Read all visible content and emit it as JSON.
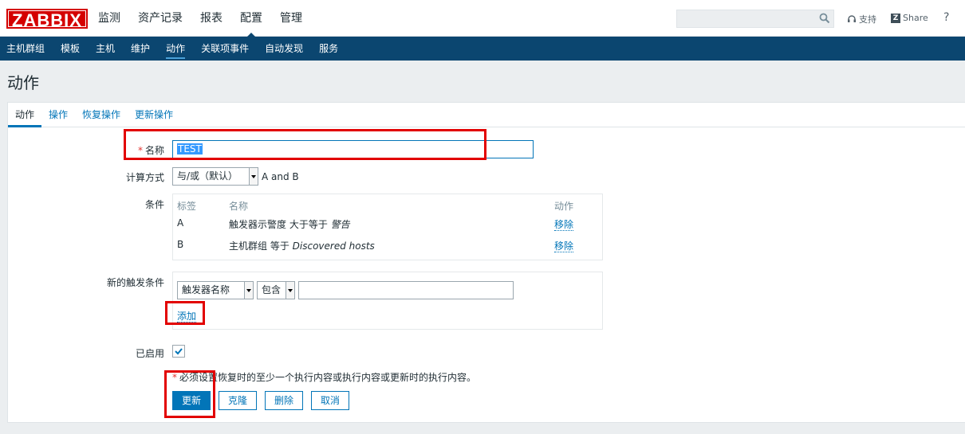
{
  "header": {
    "logo": "ZABBIX",
    "nav": [
      "监测",
      "资产记录",
      "报表",
      "配置",
      "管理"
    ],
    "support": "支持",
    "share": "Share",
    "help": "?"
  },
  "subnav": [
    "主机群组",
    "模板",
    "主机",
    "维护",
    "动作",
    "关联项事件",
    "自动发现",
    "服务"
  ],
  "page_title": "动作",
  "tabs": [
    "动作",
    "操作",
    "恢复操作",
    "更新操作"
  ],
  "form": {
    "name_label": "名称",
    "required_mark": "*",
    "name_value": "TEST",
    "calc_label": "计算方式",
    "calc_value": "与/或（默认）",
    "calc_formula": "A and B",
    "conditions_label": "条件",
    "conditions_headers": {
      "label": "标签",
      "name": "名称",
      "action": "动作"
    },
    "conditions": [
      {
        "label": "A",
        "prefix": "触发器示警度 大于等于 ",
        "value": "警告",
        "action": "移除"
      },
      {
        "label": "B",
        "prefix": "主机群组 等于 ",
        "value": "Discovered hosts",
        "action": "移除"
      }
    ],
    "new_condition_label": "新的触发条件",
    "new_condition_type": "触发器名称",
    "new_condition_op": "包含",
    "new_condition_value": "",
    "add_link": "添加",
    "enabled_label": "已启用",
    "note": "必须设置恢复时的至少一个执行内容或执行内容或更新时的执行内容。"
  },
  "buttons": {
    "update": "更新",
    "clone": "克隆",
    "delete": "删除",
    "cancel": "取消"
  },
  "colors": {
    "accent": "#0275b8",
    "header": "#0b4670",
    "logo": "#d40000",
    "highlight": "#e20000"
  }
}
